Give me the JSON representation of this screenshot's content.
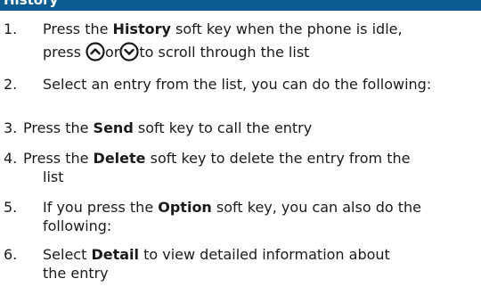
{
  "header": {
    "title": "History"
  },
  "steps": [
    {
      "num": "1.",
      "pre": "Press the ",
      "bold": "History",
      "post": " soft key when the phone is idle,",
      "line2_pre": "press ",
      "line2_mid": "or",
      "line2_post": "to scroll through the list",
      "icons": [
        "scroll-up-icon",
        "scroll-down-icon"
      ]
    },
    {
      "num": "2.",
      "text": "Select an entry from the list, you can do the following:"
    },
    {
      "num": "3.",
      "pre": "Press the ",
      "bold": "Send",
      "post": " soft key to call the entry"
    },
    {
      "num": "4.",
      "pre": "Press the ",
      "bold": "Delete",
      "post": " soft key to delete the entry from the",
      "cont": "list"
    },
    {
      "num": "5.",
      "pre": "If you press the ",
      "bold": "Option",
      "post": " soft key, you can also do the",
      "cont": "following:"
    },
    {
      "num": "6.",
      "pre": "Select ",
      "bold": "Detail",
      "post": " to view detailed information about",
      "cont": "the entry"
    }
  ],
  "colors": {
    "header_bg": "#0b5c93",
    "text": "#1a1a1a",
    "icon_stroke": "#1a1a1a"
  }
}
